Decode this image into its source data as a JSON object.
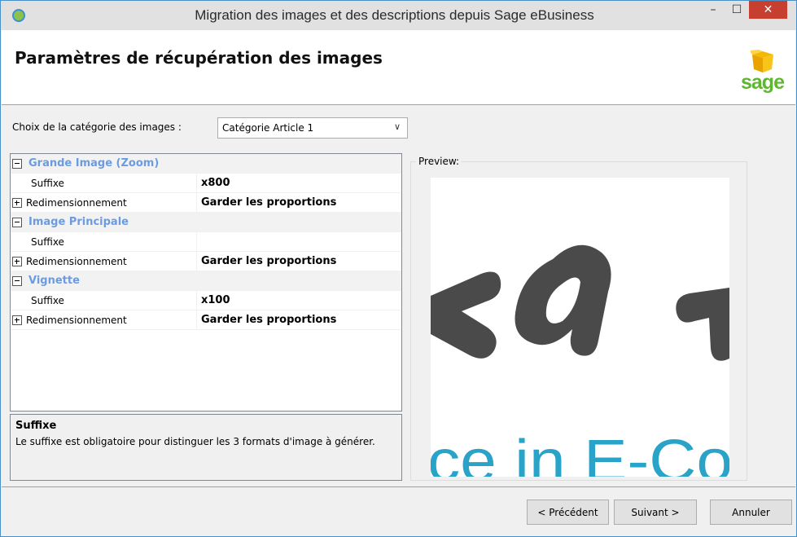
{
  "window": {
    "title": "Migration des images et des descriptions depuis Sage eBusiness",
    "close_glyph": "✕",
    "minimize_glyph": "–",
    "maximize_glyph": "☐"
  },
  "header": {
    "title": "Paramètres de récupération des images",
    "logo_text": "sage",
    "logo_color": "#5fb630",
    "logo_box_color": "#f5b800"
  },
  "category": {
    "label": "Choix de la catégorie des images :",
    "selected": "Catégorie Article 1"
  },
  "grid": {
    "groups": [
      {
        "title": "Grande Image (Zoom)",
        "suffix_label": "Suffixe",
        "suffix_value": "x800",
        "resize_label": "Redimensionnement",
        "resize_value": "Garder les proportions"
      },
      {
        "title": "Image Principale",
        "suffix_label": "Suffixe",
        "suffix_value": "",
        "resize_label": "Redimensionnement",
        "resize_value": "Garder les proportions"
      },
      {
        "title": "Vignette",
        "suffix_label": "Suffixe",
        "suffix_value": "x100",
        "resize_label": "Redimensionnement",
        "resize_value": "Garder les proportions"
      }
    ],
    "category_color": "#6b9be0"
  },
  "help": {
    "title": "Suffixe",
    "text": "Le suffixe est obligatoire pour distinguer les 3 formats d'image à générer."
  },
  "preview": {
    "label": "Preview:",
    "image_text": "ce in E-Co",
    "text_color": "#2aa3c8",
    "logo_color": "#4a4a4a"
  },
  "footer": {
    "prev_label": "< Précédent",
    "next_label": "Suivant >",
    "cancel_label": "Annuler"
  }
}
